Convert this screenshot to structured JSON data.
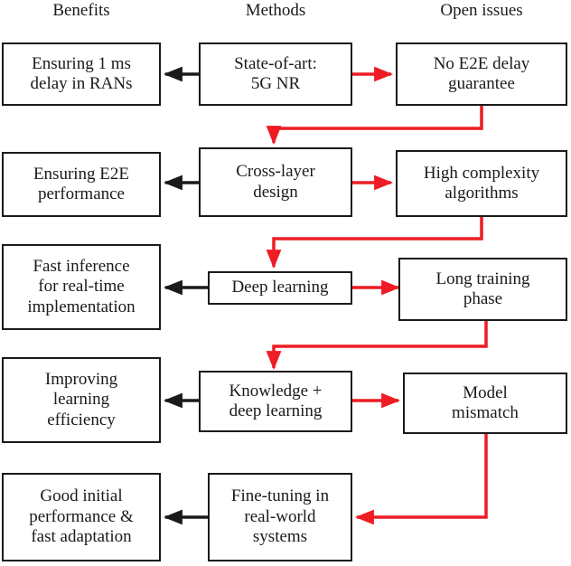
{
  "diagram": {
    "title_columns": [
      {
        "id": "benefits",
        "label": "Benefits"
      },
      {
        "id": "methods",
        "label": "Methods"
      },
      {
        "id": "open_issues",
        "label": "Open issues"
      }
    ],
    "colors": {
      "node_border": "#1a1a1a",
      "node_fill": "#ffffff",
      "benefit_arrow": "#1a1a1a",
      "issue_arrow": "#ee1c25",
      "text": "#1a1a1a"
    },
    "rows": [
      {
        "benefit": "Ensuring 1 ms\ndelay in RANs",
        "method": "State-of-art:\n5G NR",
        "issue": "No E2E delay\nguarantee"
      },
      {
        "benefit": "Ensuring E2E\nperformance",
        "method": "Cross-layer\ndesign",
        "issue": "High complexity\nalgorithms"
      },
      {
        "benefit": "Fast inference\nfor real-time\nimplementation",
        "method": "Deep learning",
        "issue": "Long training\nphase"
      },
      {
        "benefit": "Improving\nlearning\nefficiency",
        "method": "Knowledge +\ndeep learning",
        "issue": "Model\nmismatch"
      },
      {
        "benefit": "Good initial\nperformance &\nfast adaptation",
        "method": "Fine-tuning in\nreal-world\nsystems",
        "issue": null
      }
    ]
  }
}
